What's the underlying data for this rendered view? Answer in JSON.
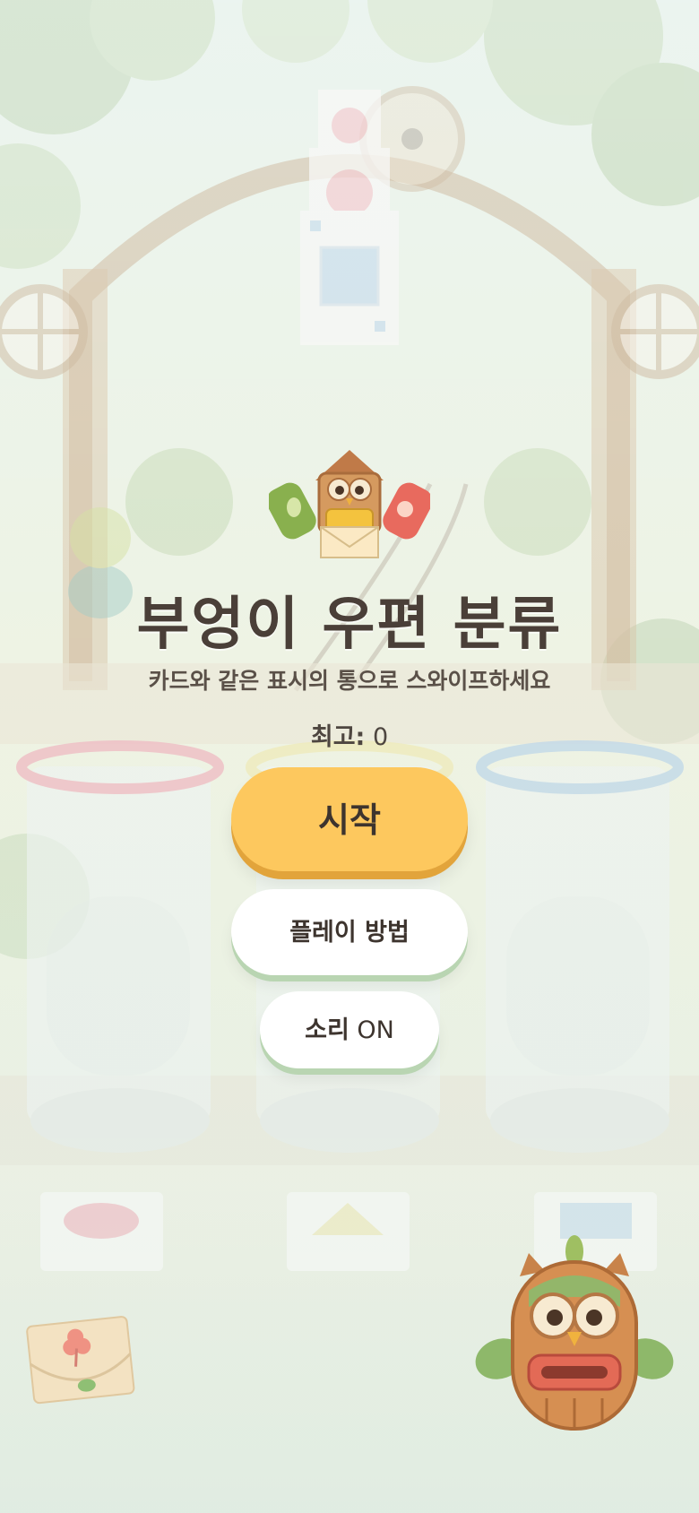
{
  "game": {
    "title": "부엉이 우편 분류",
    "subtitle": "카드와 같은 표시의 통으로 스와이프하세요",
    "best_label": "최고:",
    "best_score": "0"
  },
  "buttons": {
    "start_label": "시작",
    "how_to_play_label": "플레이 방법",
    "sound_word": "소리",
    "sound_state": "ON"
  },
  "bins": [
    {
      "symbol": "circle",
      "color": "#e9a3ad"
    },
    {
      "symbol": "triangle",
      "color": "#e9e3a0"
    },
    {
      "symbol": "square",
      "color": "#a9c9e0"
    }
  ],
  "colors": {
    "accent": "#fdc85e",
    "accent_shadow": "#e2a43b",
    "button_shadow": "#b9d5b2",
    "text": "#4a3f38"
  },
  "icons": {
    "logo": "owl-mailbox-icon",
    "mascot": "owl-mascot-icon",
    "letter": "clover-envelope-icon"
  }
}
